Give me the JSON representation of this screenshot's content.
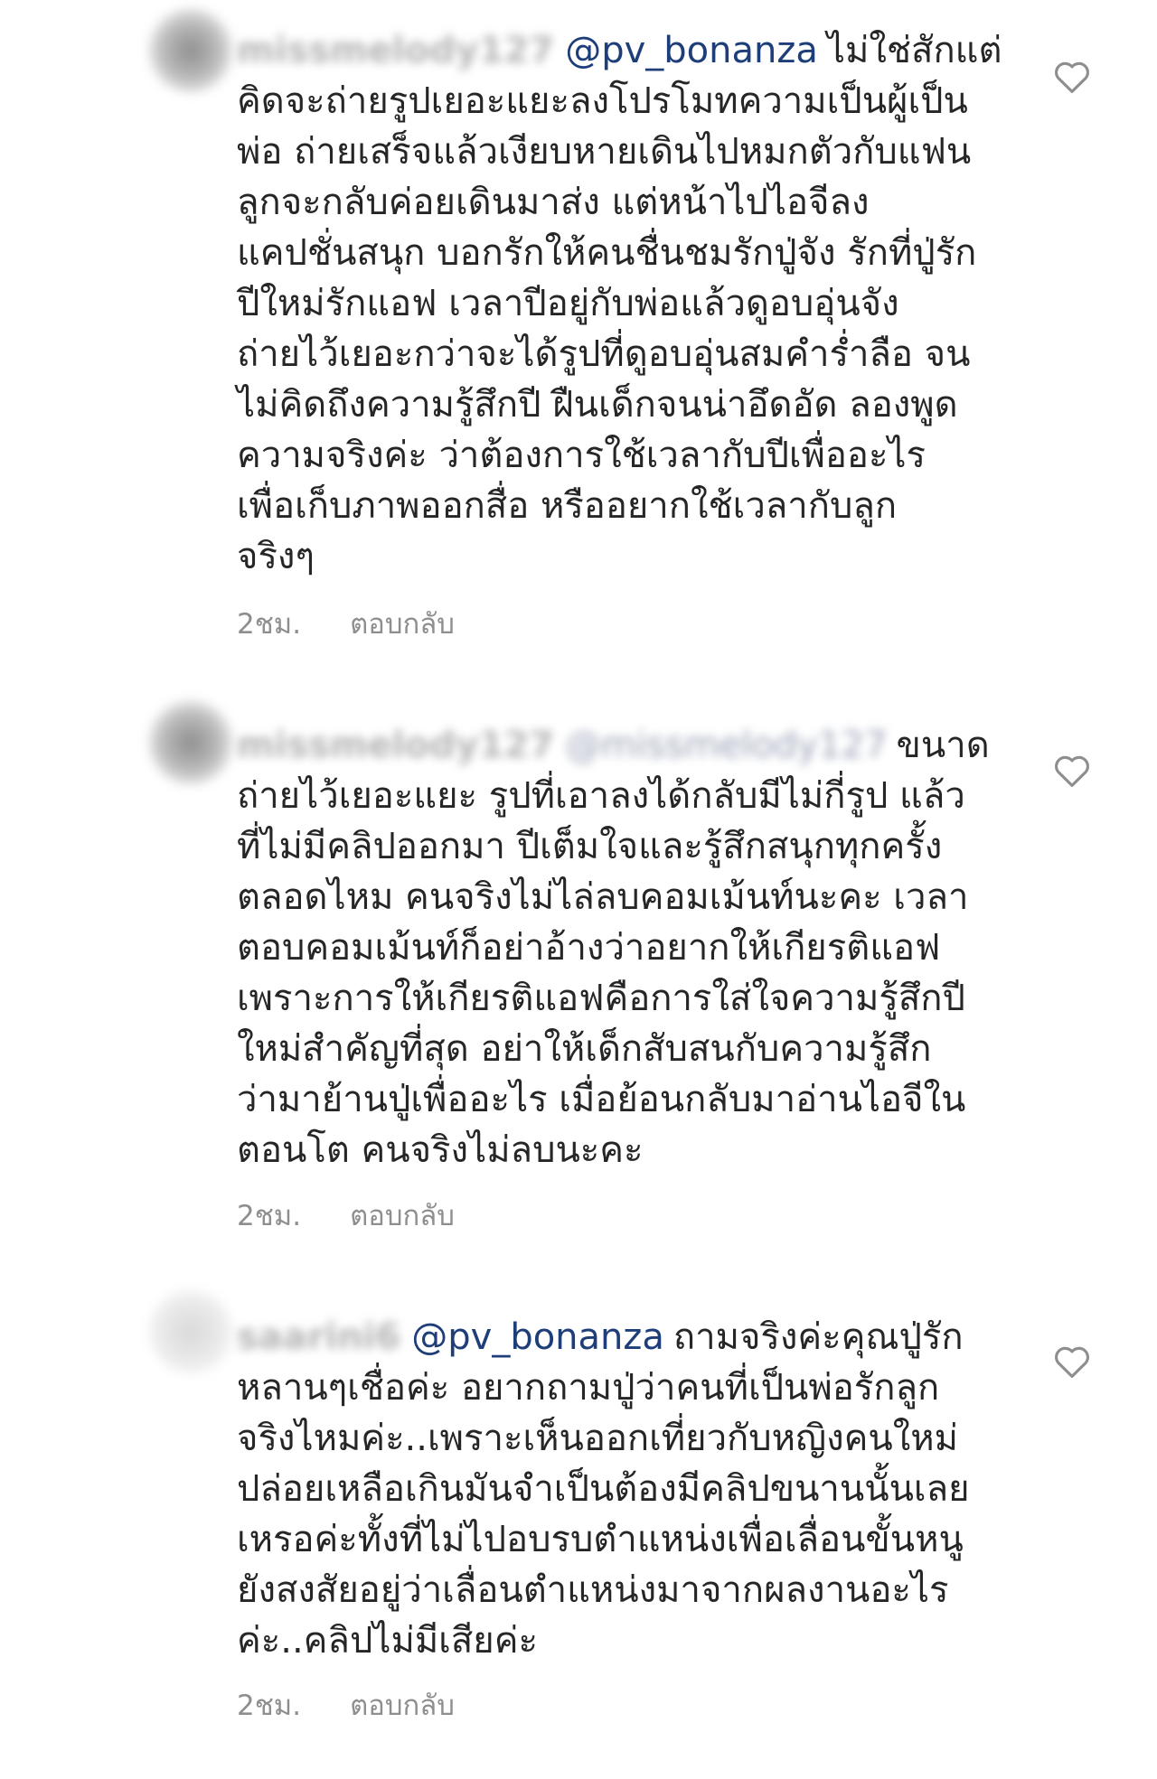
{
  "comments": [
    {
      "username": "missmelody127",
      "mention": "@pv_bonanza",
      "text": "ไม่ใช่สักแต่\nคิดจะถ่ายรูปเยอะแยะลงโปรโมทความเป็นผู้เป็น\nพ่อ ถ่ายเสร็จแล้วเงียบหายเดินไปหมกตัวกับแฟน\nลูกจะกลับค่อยเดินมาส่ง แต่หน้าไปไอจีลง\nแคปชั่นสนุก บอกรักให้คนชื่นชมรักปู่จัง รักที่ปู่รัก\nปีใหม่รักแอฟ เวลาปีอยู่กับพ่อแล้วดูอบอุ่นจัง\nถ่ายไว้เยอะกว่าจะได้รูปที่ดูอบอุ่นสมคำร่ำลือ จน\nไม่คิดถึงความรู้สึกปี ฝืนเด็กจนน่าอึดอัด ลองพูด\nความจริงค่ะ ว่าต้องการใช้เวลากับปีเพื่ออะไร\nเพื่อเก็บภาพออกสื่อ หรืออยากใช้เวลากับลูก\nจริงๆ",
      "time": "2ชม.",
      "reply": "ตอบกลับ"
    },
    {
      "username": "missmelody127",
      "mention": "@missmelody127",
      "text": "ขนาด\nถ่ายไว้เยอะแยะ รูปที่เอาลงได้กลับมีไม่กี่รูป แล้ว\nที่ไม่มีคลิปออกมา ปีเต็มใจและรู้สึกสนุกทุกครั้ง\nตลอดไหม คนจริงไม่ไล่ลบคอมเม้นท์นะคะ เวลา\nตอบคอมเม้นท์ก็อย่าอ้างว่าอยากให้เกียรติแอฟ\nเพราะการให้เกียรติแอฟคือการใส่ใจความรู้สึกปี\nใหม่สำคัญที่สุด อย่าให้เด็กสับสนกับความรู้สึก\nว่ามาย้านปู่เพื่ออะไร เมื่อย้อนกลับมาอ่านไอจีใน\nตอนโต คนจริงไม่ลบนะคะ",
      "time": "2ชม.",
      "reply": "ตอบกลับ"
    },
    {
      "username": "saarini6",
      "mention": "@pv_bonanza",
      "text": "ถามจริงค่ะคุณปู่รัก\nหลานๆเชื่อค่ะ อยากถามปู่ว่าคนที่เป็นพ่อรักลูก\nจริงไหมค่ะ..เพราะเห็นออกเที่ยวกับหญิงคนใหม่\nปล่อยเหลือเกินมันจำเป็นต้องมีคลิปขนานนั้นเลย\nเหรอค่ะทั้งที่ไม่ไปอบรบตำแหน่งเพื่อเลื่อนขั้นหนู\nยังสงสัยอยู่ว่าเลื่อนตำแหน่งมาจากผลงานอะไร\nค่ะ..คลิปไม่มีเสียค่ะ",
      "time": "2ชม.",
      "reply": "ตอบกลับ"
    }
  ],
  "icons": {
    "like": "heart-outline-icon"
  },
  "colors": {
    "mention": "#1e3e7a",
    "meta": "#8e8e8e",
    "text": "#262626"
  }
}
